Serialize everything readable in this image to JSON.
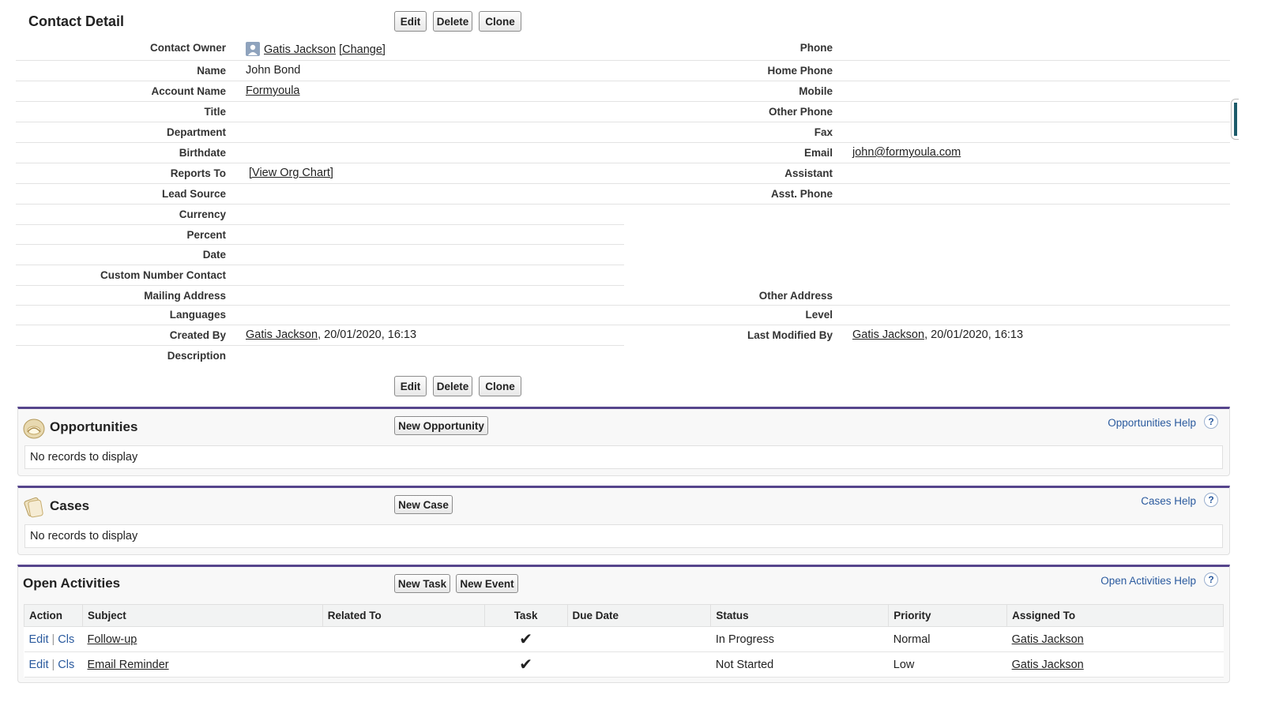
{
  "detail": {
    "title": "Contact Detail",
    "buttons": {
      "edit": "Edit",
      "delete": "Delete",
      "clone": "Clone"
    },
    "left": {
      "contact_owner_label": "Contact Owner",
      "contact_owner_name": "Gatis Jackson",
      "change_link": "[Change]",
      "name_label": "Name",
      "name_value": "John Bond",
      "account_label": "Account Name",
      "account_value": "Formyoula",
      "title_label": "Title",
      "department_label": "Department",
      "birthdate_label": "Birthdate",
      "reports_to_label": "Reports To",
      "org_chart_link": "[View Org Chart]",
      "lead_source_label": "Lead Source",
      "currency_label": "Currency",
      "percent_label": "Percent",
      "date_label": "Date",
      "custom_number_label": "Custom Number Contact",
      "mailing_address_label": "Mailing Address",
      "languages_label": "Languages",
      "created_by_label": "Created By",
      "created_by_name": "Gatis Jackson",
      "created_by_date": ", 20/01/2020, 16:13",
      "description_label": "Description"
    },
    "right": {
      "phone_label": "Phone",
      "home_phone_label": "Home Phone",
      "mobile_label": "Mobile",
      "other_phone_label": "Other Phone",
      "fax_label": "Fax",
      "email_label": "Email",
      "email_value": "john@formyoula.com",
      "assistant_label": "Assistant",
      "asst_phone_label": "Asst. Phone",
      "other_address_label": "Other Address",
      "level_label": "Level",
      "last_modified_label": "Last Modified By",
      "last_modified_name": "Gatis Jackson",
      "last_modified_date": ", 20/01/2020, 16:13"
    }
  },
  "opportunities": {
    "title": "Opportunities",
    "new_button": "New Opportunity",
    "help": "Opportunities Help",
    "empty": "No records to display"
  },
  "cases": {
    "title": "Cases",
    "new_button": "New Case",
    "help": "Cases Help",
    "empty": "No records to display"
  },
  "activities": {
    "title": "Open Activities",
    "new_task": "New Task",
    "new_event": "New Event",
    "help": "Open Activities Help",
    "help_glyph": "?",
    "columns": [
      "Action",
      "Subject",
      "Related To",
      "Task",
      "Due Date",
      "Status",
      "Priority",
      "Assigned To"
    ],
    "rows": [
      {
        "edit": "Edit",
        "sep": "|",
        "cls": "Cls",
        "subject": "Follow-up",
        "related": "",
        "task": "✔",
        "due": "",
        "status": "In Progress",
        "priority": "Normal",
        "assigned": "Gatis Jackson"
      },
      {
        "edit": "Edit",
        "sep": "|",
        "cls": "Cls",
        "subject": "Email Reminder",
        "related": "",
        "task": "✔",
        "due": "",
        "status": "Not Started",
        "priority": "Low",
        "assigned": "Gatis Jackson"
      }
    ]
  },
  "colors": {
    "section_border": "#56458c",
    "link_blue": "#2a5a9e"
  }
}
